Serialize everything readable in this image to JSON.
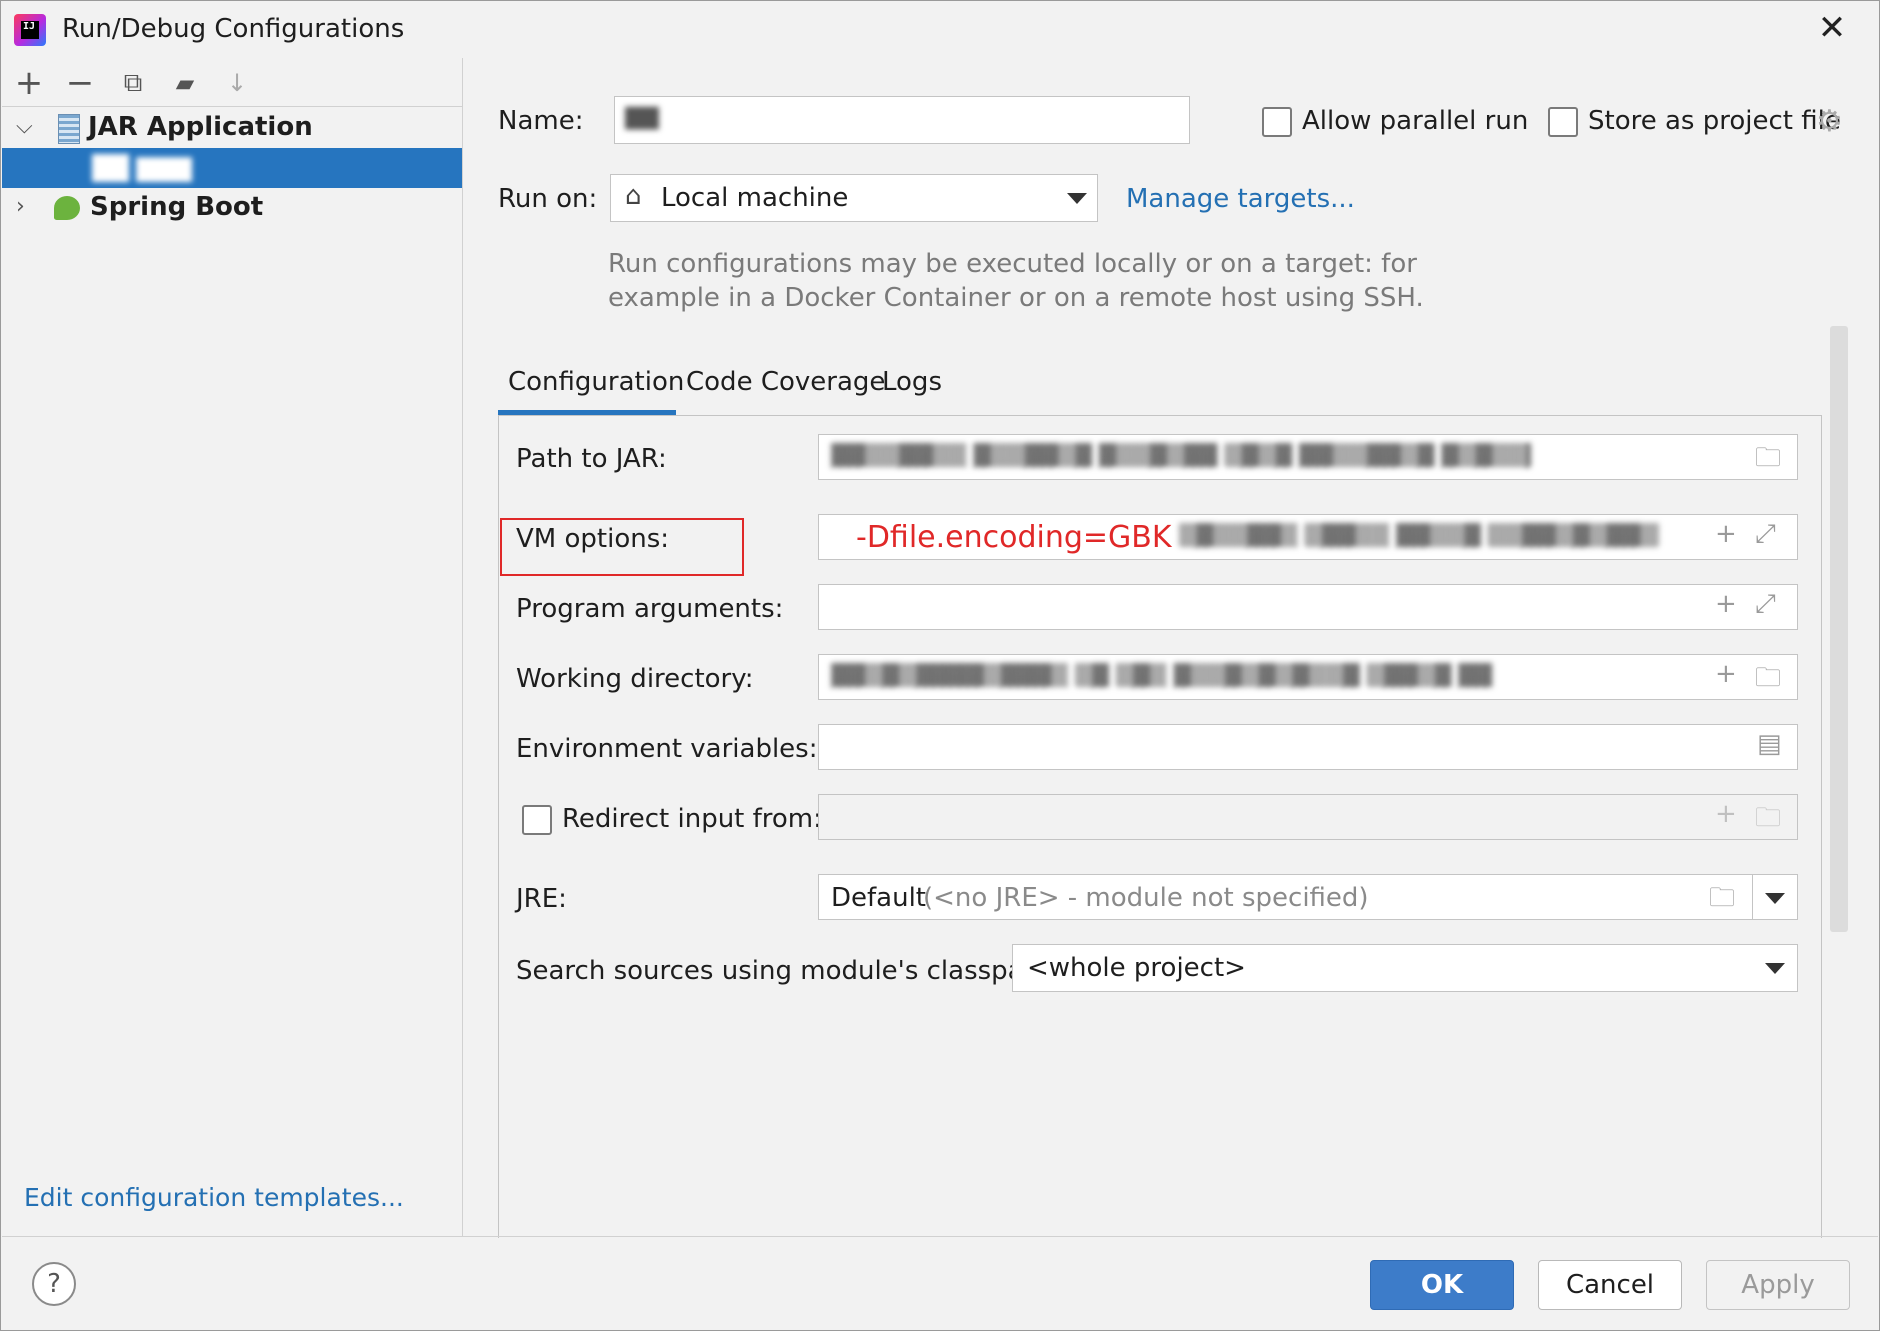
{
  "window": {
    "title": "Run/Debug Configurations",
    "close_glyph": "✕"
  },
  "toolbar": {
    "add": "+",
    "remove": "−",
    "copy": "⧉",
    "folder": "▰",
    "sort": "↓"
  },
  "tree": {
    "jar_application": "JAR Application",
    "selected_item": "██ ▇▇▇",
    "spring_boot": "Spring Boot"
  },
  "left_footer": {
    "edit_templates": "Edit configuration templates..."
  },
  "header": {
    "name_label": "Name:",
    "name_value": "▇▇",
    "allow_parallel_run": "Allow parallel run",
    "store_as_project_file": "Store as project file",
    "run_on_label": "Run on:",
    "run_on_value": "Local machine",
    "manage_targets": "Manage targets...",
    "hint_line1": "Run configurations may be executed locally or on a target: for",
    "hint_line2": "example in a Docker Container or on a remote host using SSH."
  },
  "tabs": [
    {
      "label": "Configuration",
      "active": true
    },
    {
      "label": "Code Coverage",
      "active": false
    },
    {
      "label": "Logs",
      "active": false
    }
  ],
  "config": {
    "path_to_jar_label": "Path to JAR:",
    "path_to_jar_value": "▓▓▒▒▓▓▒▒ ▓▒▒▓▓▒▓ ▓▒▒▓▒▓▓ ▒▓▒▓ ▓▓▒▒▓▓▒▓ ▓▒▓▒▒▓ ▓▓▒▓▒ ▒▓▓▒",
    "vm_options_label": "VM options:",
    "vm_options_value": "-Dfile.encoding=GBK",
    "vm_options_rest": "▒▓▒▒▓▓▒ ▒▓▓▒▒ ▓▓▒▒▓ ▒▒▓▓▒▓▒▓▓▒▒▓",
    "program_arguments_label": "Program arguments:",
    "program_arguments_value": "",
    "working_directory_label": "Working directory:",
    "working_directory_value": "▓▓▒▓▒▓▓▓▓▒▓▓▓▒ ▒▓ ▒▓▒ ▓▒▒▓▒▓▒▓▒▒▓ ▒▓▓▒▓ ▓▓",
    "environment_variables_label": "Environment variables:",
    "environment_variables_value": "",
    "redirect_input_label": "Redirect input from:",
    "jre_label": "JRE:",
    "jre_value": "Default",
    "jre_hint": "(<no JRE> - module not specified)",
    "search_sources_label": "Search sources using module's classpath:",
    "search_sources_value": "<whole project>"
  },
  "buttons": {
    "ok": "OK",
    "cancel": "Cancel",
    "apply": "Apply",
    "help": "?"
  },
  "colors": {
    "accent": "#2675bf",
    "link": "#2470b3",
    "annotation_red": "#e02828",
    "ok_button": "#3d7cc9"
  }
}
